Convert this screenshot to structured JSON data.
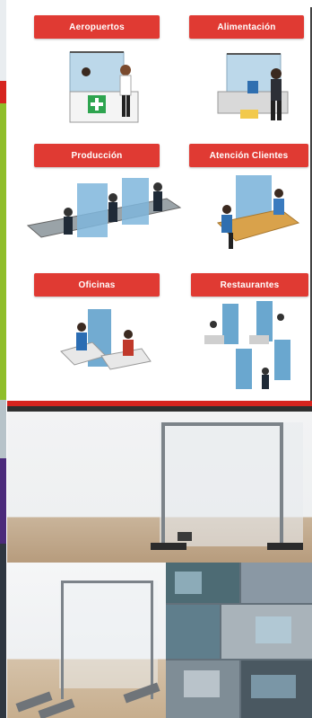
{
  "labels": {
    "aeropuertos": "Aeropuertos",
    "alimentacion": "Alimentación",
    "produccion": "Producción",
    "atencion_clientes": "Atención Clientes",
    "oficinas": "Oficinas",
    "restaurantes": "Restaurantes"
  },
  "colors": {
    "accent_red": "#e03a33",
    "panel_blue": "#6aa7cf",
    "left_strip_green": "#8fbe2a",
    "left_strip_purple": "#4b2a7b"
  }
}
